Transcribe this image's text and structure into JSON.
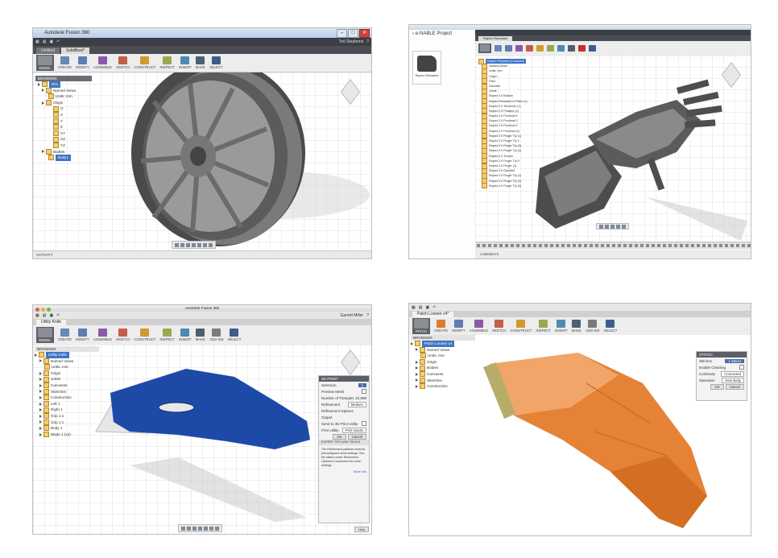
{
  "screens": {
    "wheel": {
      "title": "Autodesk Fusion 360",
      "user": "Tod Stephens",
      "tab_start": "Untitled",
      "tab_active": "SolidBest*",
      "workspace_label": "MODEL",
      "tools": [
        "CREATE",
        "MODIFY",
        "ASSEMBLE",
        "SKETCH",
        "CONSTRUCT",
        "INSPECT",
        "INSERT",
        "MAKE",
        "SELECT"
      ],
      "browser_title": "BROWSER",
      "browser_items": [
        "Rim",
        "Named Views",
        "Units: mm",
        "Origin",
        "O",
        "X",
        "Y",
        "Z",
        "XY",
        "XZ",
        "YZ",
        "Bodies",
        "Body1"
      ],
      "status": "ACTIVITY"
    },
    "hand": {
      "project": "e-NABLE Project",
      "tab_active": "Raptor Reloaded",
      "thumb_label": "Raptor Reloaded",
      "tooltip_title": "3D PRINT (Cycle)",
      "tooltip_sub": "Export to 3D Print",
      "browser_items": [
        "Raptor Reloaded (Unsaved)",
        "Named Views",
        "Units: mm",
        "Origin",
        "Palm",
        "Gauntlet",
        "Joints",
        "Raptor 2.0 Bottom",
        "Raptor Reloaded v2.Palm (1)",
        "Raptor 2.0 Tensioner (1)",
        "Raptor 2.0 Phalanx (1)",
        "Raptor 2.0 Proximal 4",
        "Raptor 2.0 Proximal 3",
        "Raptor 2.0 Proximal 2",
        "Raptor 2.0 Proximal (1)",
        "Raptor 2.0 Finger Tip (1)",
        "Raptor 2.0 Finger Tip 2",
        "Raptor 2.0 Finger Tip (3)",
        "Raptor 2.0 Finger Tip (4)",
        "Raptor 2.0 Thumb",
        "Raptor 2.0 Finger Tip 5",
        "Raptor 2.0 Finger (1)",
        "Raptor 2.0 Gauntlet",
        "Raptor 2.0 Finger Tip (2)",
        "Raptor 2.0 Finger Tip (3)",
        "Raptor 2.0 Finger Tip (4)"
      ],
      "comments": "COMMENTS"
    },
    "knife": {
      "title": "Autodesk Fusion 360",
      "user": "Garrett Miller",
      "tab_active": "Utility Knife",
      "workspace_label": "MODEL",
      "tools": [
        "CREATE",
        "MODIFY",
        "ASSEMBLE",
        "SKETCH",
        "CONSTRUCT",
        "INSPECT",
        "INSERT",
        "MAKE",
        "ADD-INS",
        "SELECT"
      ],
      "browser_title": "BROWSER",
      "browser_items": [
        "Utility Knife",
        "Named Views",
        "Units: mm",
        "Origin",
        "Joints",
        "Canvases",
        "Sketches",
        "Construction",
        "Left 1",
        "Right 1",
        "Grip 1:1",
        "Grip 1:1",
        "Body 1",
        "Blade 1 (v4)"
      ],
      "panel": {
        "title": "3D PRINT",
        "rows": [
          {
            "label": "Selection",
            "value": "1"
          },
          {
            "label": "Preview Mesh",
            "value": ""
          },
          {
            "label": "Number of Triangles",
            "value": "22,888"
          },
          {
            "label": "Refinement",
            "value": "Medium"
          },
          {
            "label": "Refinement Options",
            "value": ""
          },
          {
            "label": "Output",
            "value": ""
          },
          {
            "label": "Send to 3D Print Utility",
            "value": ""
          },
          {
            "label": "Print Utility",
            "value": "Print Studio"
          }
        ],
        "ok": "OK",
        "cancel": "Cancel",
        "tips_title": "EXPERT TIPS AND TRICKS",
        "tips_text": "The Refinement pulldown controls preconfigured mesh settings. See the sliders under Refinement Options to customize the mesh settings.",
        "more": "More info"
      },
      "help": "Help"
    },
    "patch": {
      "tab_active": "Patch Loosen v4*",
      "workspace_label": "PATCH",
      "tools": [
        "CREATE",
        "MODIFY",
        "ASSEMBLE",
        "SKETCH",
        "CONSTRUCT",
        "INSPECT",
        "INSERT",
        "MAKE",
        "ADD-INS",
        "SELECT"
      ],
      "browser_title": "BROWSER",
      "browser_items": [
        "Patch Loosen v4",
        "Named Views",
        "Units: mm",
        "Origin",
        "Bodies",
        "Canvases",
        "Sketches",
        "Construction"
      ],
      "panel": {
        "title": "STITCH",
        "rows": [
          {
            "label": "Stitches",
            "value": "1 Select"
          },
          {
            "label": "Enable Cleaning",
            "value": ""
          },
          {
            "label": "Continuity",
            "value": "Connected"
          },
          {
            "label": "Operation",
            "value": "New Body"
          }
        ],
        "ok": "OK",
        "cancel": "Cancel"
      }
    }
  },
  "colors": {
    "mesh_blue": "#1d4aa6",
    "orange": "#e58235",
    "metal": "#6a6a6a",
    "toolbar_dark": "#3b3f45"
  }
}
